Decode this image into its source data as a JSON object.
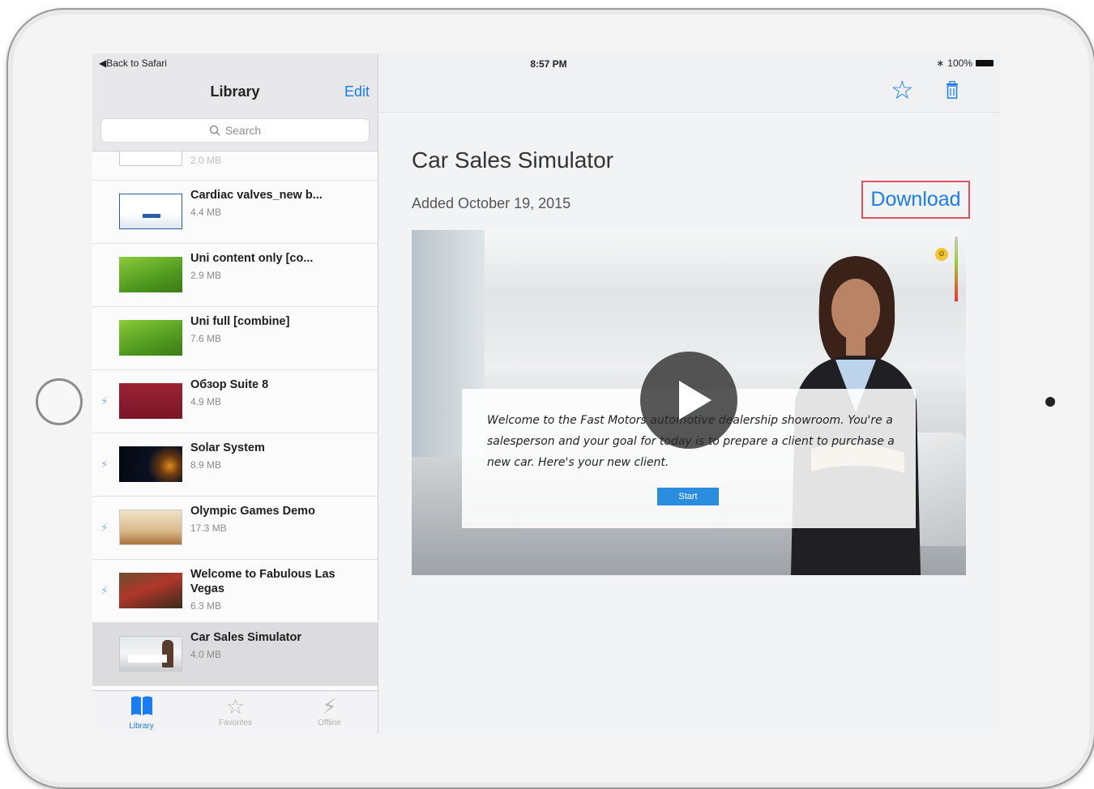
{
  "status_bar": {
    "back_label": "Back to Safari",
    "time": "8:57 PM",
    "battery": "100%"
  },
  "sidebar": {
    "title": "Library",
    "edit_label": "Edit",
    "search_placeholder": "Search",
    "items": [
      {
        "name": "",
        "size": "2.0 MB",
        "flash": false
      },
      {
        "name": "Cardiac valves_new b...",
        "size": "4.4 MB",
        "flash": false
      },
      {
        "name": "Uni content only [co...",
        "size": "2.9 MB",
        "flash": false
      },
      {
        "name": "Uni full [combine]",
        "size": "7.6 MB",
        "flash": false
      },
      {
        "name": "Обзор Suite 8",
        "size": "4.9 MB",
        "flash": true
      },
      {
        "name": "Solar System",
        "size": "8.9 MB",
        "flash": true
      },
      {
        "name": "Olympic Games Demo",
        "size": "17.3 MB",
        "flash": true
      },
      {
        "name": "Welcome to Fabulous Las Vegas",
        "size": "6.3 MB",
        "flash": true
      },
      {
        "name": "Car Sales Simulator",
        "size": "4.0 MB",
        "flash": false,
        "selected": true
      }
    ]
  },
  "tabbar": {
    "tabs": [
      {
        "label": "Library",
        "active": true
      },
      {
        "label": "Favorites",
        "active": false
      },
      {
        "label": "Offline",
        "active": false
      }
    ]
  },
  "detail": {
    "title": "Car Sales Simulator",
    "added": "Added October 19, 2015",
    "download_label": "Download",
    "preview": {
      "dialog_text": "Welcome to the Fast Motors automotive dealership showroom. You're a salesperson and your goal for today is to prepare a client to purchase a new car. Here's your new client.",
      "start_label": "Start"
    }
  },
  "colors": {
    "accent": "#1a7cf0",
    "highlight_border": "#e0515e"
  }
}
